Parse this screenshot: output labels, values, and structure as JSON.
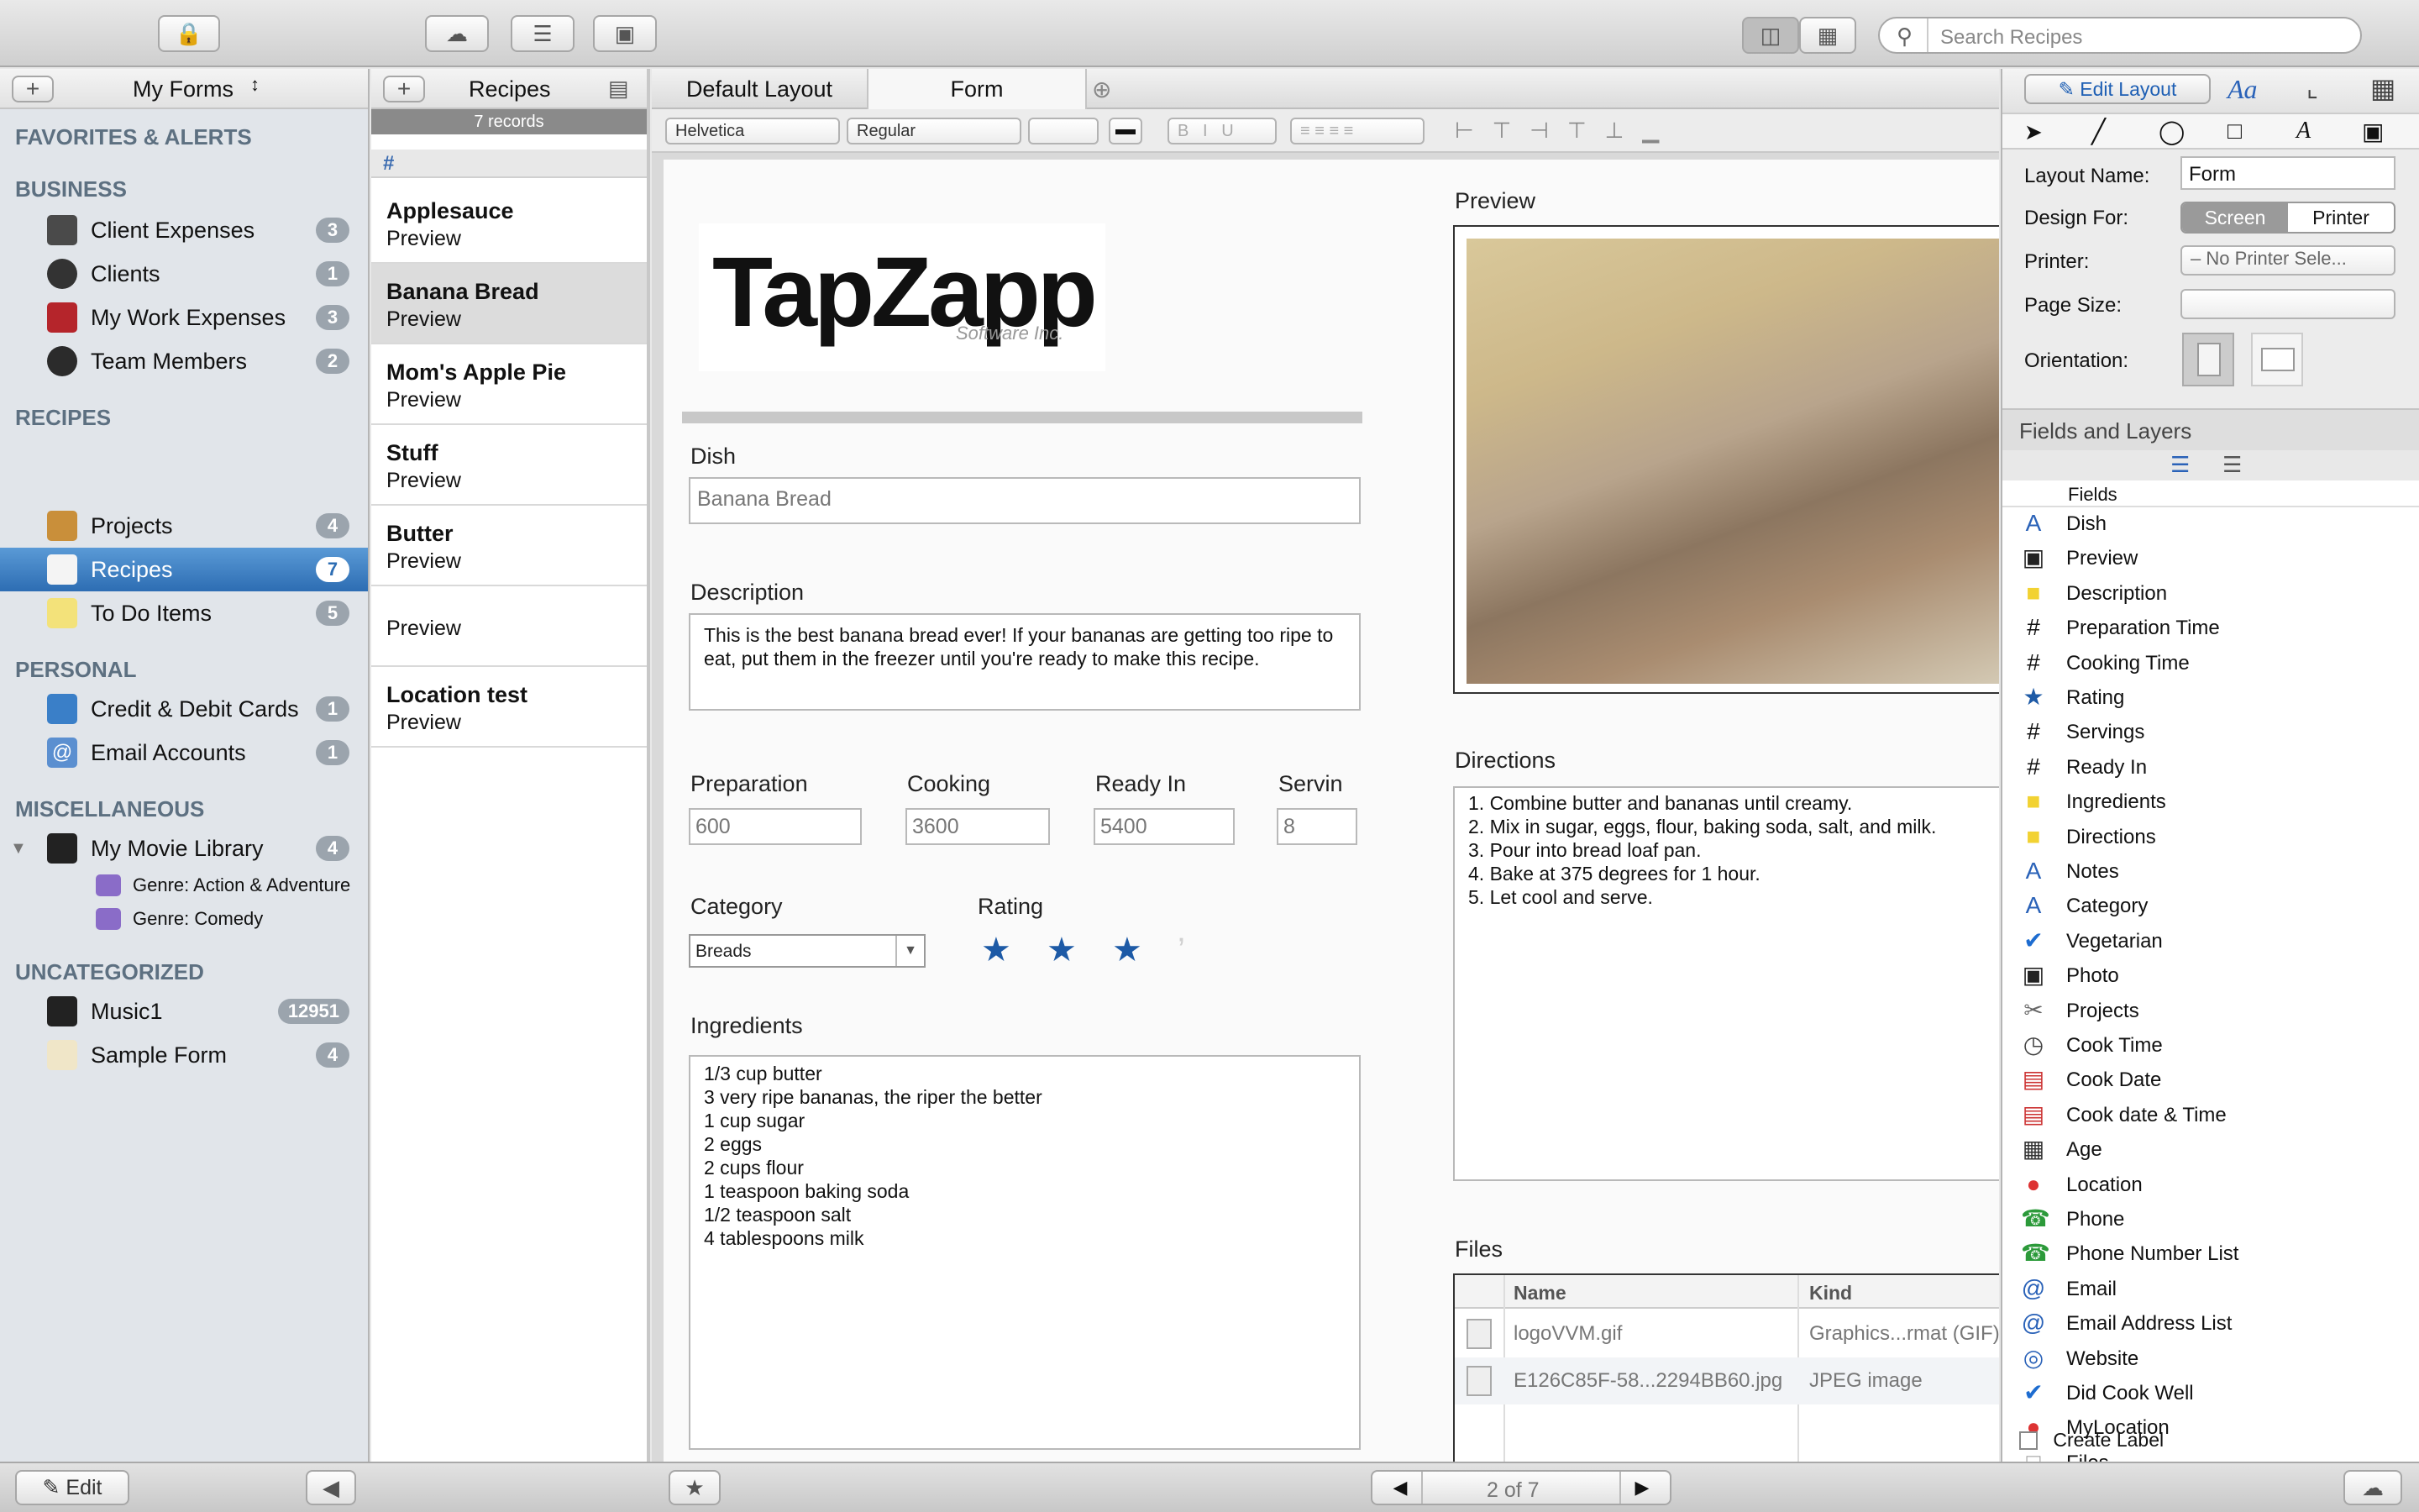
{
  "toolbar": {
    "search_placeholder": "Search Recipes"
  },
  "sidebar": {
    "header": "My Forms",
    "sections": {
      "favorites": "FAVORITES & ALERTS",
      "business": "BUSINESS",
      "recipes": "RECIPES",
      "personal": "PERSONAL",
      "misc": "MISCELLANEOUS",
      "uncategorized": "UNCATEGORIZED"
    },
    "items": [
      {
        "label": "Client Expenses",
        "count": "3"
      },
      {
        "label": "Clients",
        "count": "1"
      },
      {
        "label": "My Work Expenses",
        "count": "3"
      },
      {
        "label": "Team Members",
        "count": "2"
      },
      {
        "label": "Projects",
        "count": "4"
      },
      {
        "label": "Recipes",
        "count": "7"
      },
      {
        "label": "To Do Items",
        "count": "5"
      },
      {
        "label": "Credit & Debit Cards",
        "count": "1"
      },
      {
        "label": "Email Accounts",
        "count": "1"
      },
      {
        "label": "My Movie Library",
        "count": "4"
      },
      {
        "label": "Genre: Action & Adventure",
        "count": ""
      },
      {
        "label": "Genre: Comedy",
        "count": ""
      },
      {
        "label": "Music1",
        "count": "12951"
      },
      {
        "label": "Sample Form",
        "count": "4"
      }
    ],
    "edit_label": "Edit"
  },
  "records": {
    "header": "Recipes",
    "count_label": "7 records",
    "hash": "#",
    "items": [
      {
        "title": "Applesauce",
        "sub": "Preview"
      },
      {
        "title": "Banana Bread",
        "sub": "Preview"
      },
      {
        "title": "Mom's Apple Pie",
        "sub": "Preview"
      },
      {
        "title": "Stuff",
        "sub": "Preview"
      },
      {
        "title": "Butter",
        "sub": "Preview"
      },
      {
        "title": "",
        "sub": "Preview"
      },
      {
        "title": "Location test",
        "sub": "Preview"
      }
    ]
  },
  "tabs": {
    "default_layout": "Default Layout",
    "form": "Form"
  },
  "format": {
    "font": "Helvetica",
    "style": "Regular",
    "bold": "B",
    "italic": "I",
    "underline": "U"
  },
  "logo": {
    "main": "TapZapp",
    "sub": "Software Inc."
  },
  "form": {
    "dish_label": "Dish",
    "dish_value": "Banana Bread",
    "desc_label": "Description",
    "desc_value": "This is the best banana bread ever! If your bananas are getting too ripe to eat, put them in the freezer until you're ready to make this recipe.",
    "prep_label": "Preparation",
    "prep_value": "600",
    "cook_label": "Cooking",
    "cook_value": "3600",
    "ready_label": "Ready In",
    "ready_value": "5400",
    "serv_label": "Servin",
    "serv_value": "8",
    "category_label": "Category",
    "category_value": "Breads",
    "rating_label": "Rating",
    "rating_stars": 3,
    "ingredients_label": "Ingredients",
    "ingredients": [
      "1/3 cup butter",
      "3 very ripe bananas, the riper the better",
      "1 cup sugar",
      "2 eggs",
      "2 cups flour",
      "1 teaspoon baking soda",
      "1/2 teaspoon salt",
      "4 tablespoons milk"
    ],
    "preview_label": "Preview",
    "directions_label": "Directions",
    "directions": [
      "1. Combine butter and bananas until creamy.",
      "2. Mix in sugar, eggs, flour, baking soda, salt, and milk.",
      "3. Pour into bread loaf pan.",
      "4. Bake at 375 degrees for 1 hour.",
      "5. Let cool and serve."
    ],
    "files_label": "Files",
    "files_cols": [
      "Name",
      "Kind"
    ],
    "files": [
      {
        "name": "logoVVM.gif",
        "kind": "Graphics...rmat (GIF)"
      },
      {
        "name": "E126C85F-58...2294BB60.jpg",
        "kind": "JPEG image"
      }
    ]
  },
  "inspector": {
    "edit_layout": "Edit Layout",
    "layout_name_label": "Layout Name:",
    "layout_name_value": "Form",
    "design_for_label": "Design For:",
    "screen": "Screen",
    "printer": "Printer",
    "printer_label": "Printer:",
    "printer_value": "– No Printer Sele...",
    "page_size_label": "Page Size:",
    "orientation_label": "Orientation:",
    "fields_layers": "Fields and Layers",
    "fields_header": "Fields",
    "fields": [
      "Dish",
      "Preview",
      "Description",
      "Preparation Time",
      "Cooking Time",
      "Rating",
      "Servings",
      "Ready In",
      "Ingredients",
      "Directions",
      "Notes",
      "Category",
      "Vegetarian",
      "Photo",
      "Projects",
      "Cook Time",
      "Cook Date",
      "Cook date & Time",
      "Age",
      "Location",
      "Phone",
      "Phone Number List",
      "Email",
      "Email Address List",
      "Website",
      "Did Cook Well",
      "MyLocation",
      "Files"
    ],
    "field_icons": [
      "A",
      "cam",
      "note",
      "#",
      "#",
      "star",
      "#",
      "#",
      "note",
      "note",
      "A",
      "A",
      "check",
      "cam",
      "clip",
      "clock",
      "cal",
      "cal",
      "calc",
      "pin",
      "phone",
      "phone",
      "@",
      "@",
      "globe",
      "check",
      "pin",
      "file"
    ],
    "create_label": "Create Label"
  },
  "pager": {
    "label": "2 of 7"
  }
}
